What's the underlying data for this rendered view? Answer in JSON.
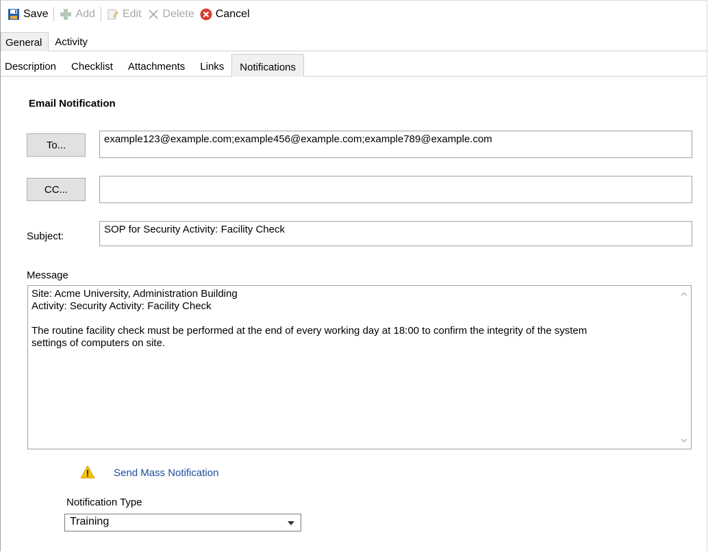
{
  "toolbar": {
    "save_label": "Save",
    "add_label": "Add",
    "edit_label": "Edit",
    "delete_label": "Delete",
    "cancel_label": "Cancel"
  },
  "tabs_primary": [
    "General",
    "Activity"
  ],
  "tabs_primary_active": "General",
  "tabs_secondary": [
    "Description",
    "Checklist",
    "Attachments",
    "Links",
    "Notifications"
  ],
  "tabs_secondary_active": "Notifications",
  "email": {
    "section_title": "Email Notification",
    "to_button": "To...",
    "to_value": "example123@example.com;example456@example.com;example789@example.com",
    "cc_button": "CC...",
    "cc_value": "",
    "subject_label": "Subject:",
    "subject_value": "SOP for Security Activity: Facility Check",
    "message_label": "Message",
    "message_lines": [
      "Site: Acme University, Administration Building",
      "Activity: Security Activity: Facility Check",
      "",
      "The routine facility check must be performed at the end of every working day at 18:00 to confirm the integrity of the system",
      "settings of computers on site."
    ]
  },
  "mass_notification_link": "Send Mass Notification",
  "notification_type": {
    "label": "Notification Type",
    "selected": "Training"
  },
  "icons": {
    "save": "save-icon",
    "add": "add-icon",
    "edit": "edit-icon",
    "delete": "delete-icon",
    "cancel": "cancel-icon",
    "warning": "warning-icon"
  },
  "colors": {
    "link": "#1a4d9e",
    "cancel_icon": "#d93b2b",
    "warning_icon": "#f4c20d",
    "save_icon": "#1f5fb0"
  }
}
